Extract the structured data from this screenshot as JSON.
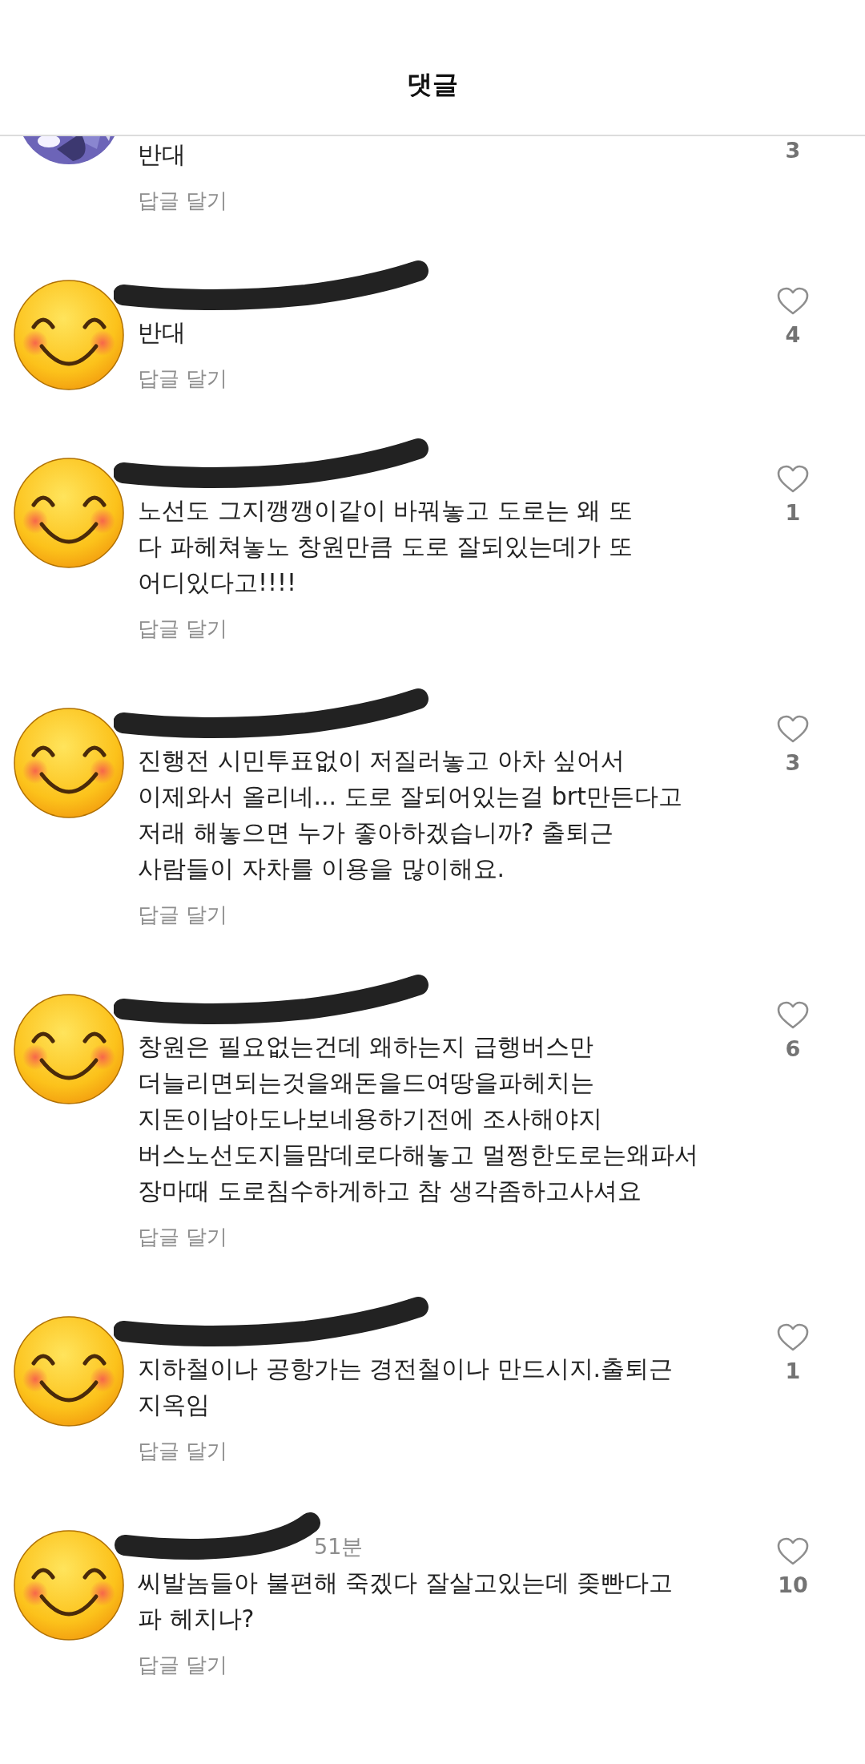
{
  "header": {
    "title": "댓글"
  },
  "comments": [
    {
      "kind": "picture",
      "cut_off": true,
      "redacted": false,
      "text": "반대",
      "likes": "3",
      "reply": "답글 달기"
    },
    {
      "kind": "emoji",
      "cut_off": false,
      "redacted": true,
      "text": "반대",
      "likes": "4",
      "reply": "답글 달기"
    },
    {
      "kind": "emoji",
      "cut_off": false,
      "redacted": true,
      "text": "노선도 그지깽깽이같이 바꿔놓고 도로는 왜 또\n다 파헤쳐놓노 창원만큼 도로 잘되있는데가 또\n어디있다고!!!!",
      "likes": "1",
      "reply": "답글 달기"
    },
    {
      "kind": "emoji",
      "cut_off": false,
      "redacted": true,
      "text": "진행전 시민투표없이 저질러놓고 아차 싶어서\n이제와서 올리네... 도로 잘되어있는걸 brt만든다고\n저래 해놓으면 누가 좋아하겠습니까? 출퇴근\n사람들이 자차를 이용을 많이해요.",
      "likes": "3",
      "reply": "답글 달기"
    },
    {
      "kind": "emoji",
      "cut_off": false,
      "redacted": true,
      "text": "창원은 필요없는건데 왜하는지 급행버스만\n더늘리면되는것을왜돈을드여땅을파헤치는\n지돈이남아도나보네용하기전에 조사해야지\n버스노선도지들맘데로다해놓고 멀쩡한도로는왜파서\n장마때 도로침수하게하고 참 생각좀하고사셔요",
      "likes": "6",
      "reply": "답글 달기"
    },
    {
      "kind": "emoji",
      "cut_off": false,
      "redacted": true,
      "text": "지하철이나  공항가는 경전철이나 만드시지.출퇴근\n지옥임",
      "likes": "1",
      "reply": "답글 달기"
    },
    {
      "kind": "emoji",
      "cut_off": false,
      "redacted": true,
      "time": "51분",
      "text": "씨발놈들아 불편해 죽겠다  잘살고있는데 좆빤다고\n파 헤치나?",
      "likes": "10",
      "reply": "답글 달기"
    }
  ]
}
